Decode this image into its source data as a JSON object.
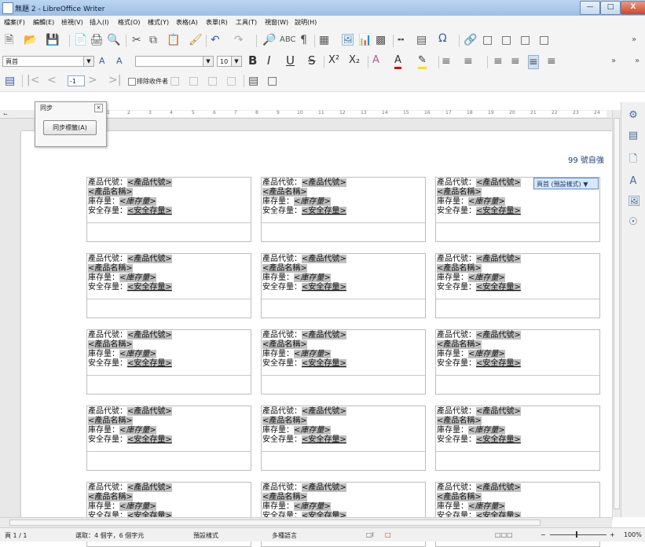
{
  "window": {
    "title": "無題 2 - LibreOffice Writer"
  },
  "menu": [
    "檔案(F)",
    "編輯(E)",
    "檢視(V)",
    "插入(I)",
    "格式(O)",
    "樣式(Y)",
    "表格(A)",
    "表單(R)",
    "工具(T)",
    "視窗(W)",
    "說明(H)"
  ],
  "toolbar2": {
    "paragraph_style": "頁首",
    "font_name": "",
    "font_size": "10"
  },
  "toolbar3": {
    "nav_value": "-1",
    "exclude_label": "排除收件者"
  },
  "sync_popup": {
    "title": "同步",
    "button": "同步標籤(A)"
  },
  "page_number": "99 號自強",
  "style_badge": "頁首 (預設樣式)",
  "label": {
    "code_prefix": "產品代號：",
    "code_field": "<產品代號>",
    "name_field": "<產品名稱>",
    "stock_prefix": "庫存量：",
    "stock_field": "<庫存量>",
    "safety_prefix": "安全存量：",
    "safety_field": "<安全存量>"
  },
  "ruler_ticks": [
    "1",
    "2",
    "3",
    "4",
    "5",
    "6",
    "7",
    "8",
    "9",
    "10",
    "11",
    "12",
    "13",
    "14",
    "15",
    "16",
    "17",
    "18",
    "19",
    "20",
    "21",
    "22",
    "23",
    "24"
  ],
  "status": {
    "page": "頁 1 / 1",
    "selection": "選取：4 個字，6 個字元",
    "page_style": "預設樣式",
    "language": "多種語言",
    "zoom": "100%"
  }
}
